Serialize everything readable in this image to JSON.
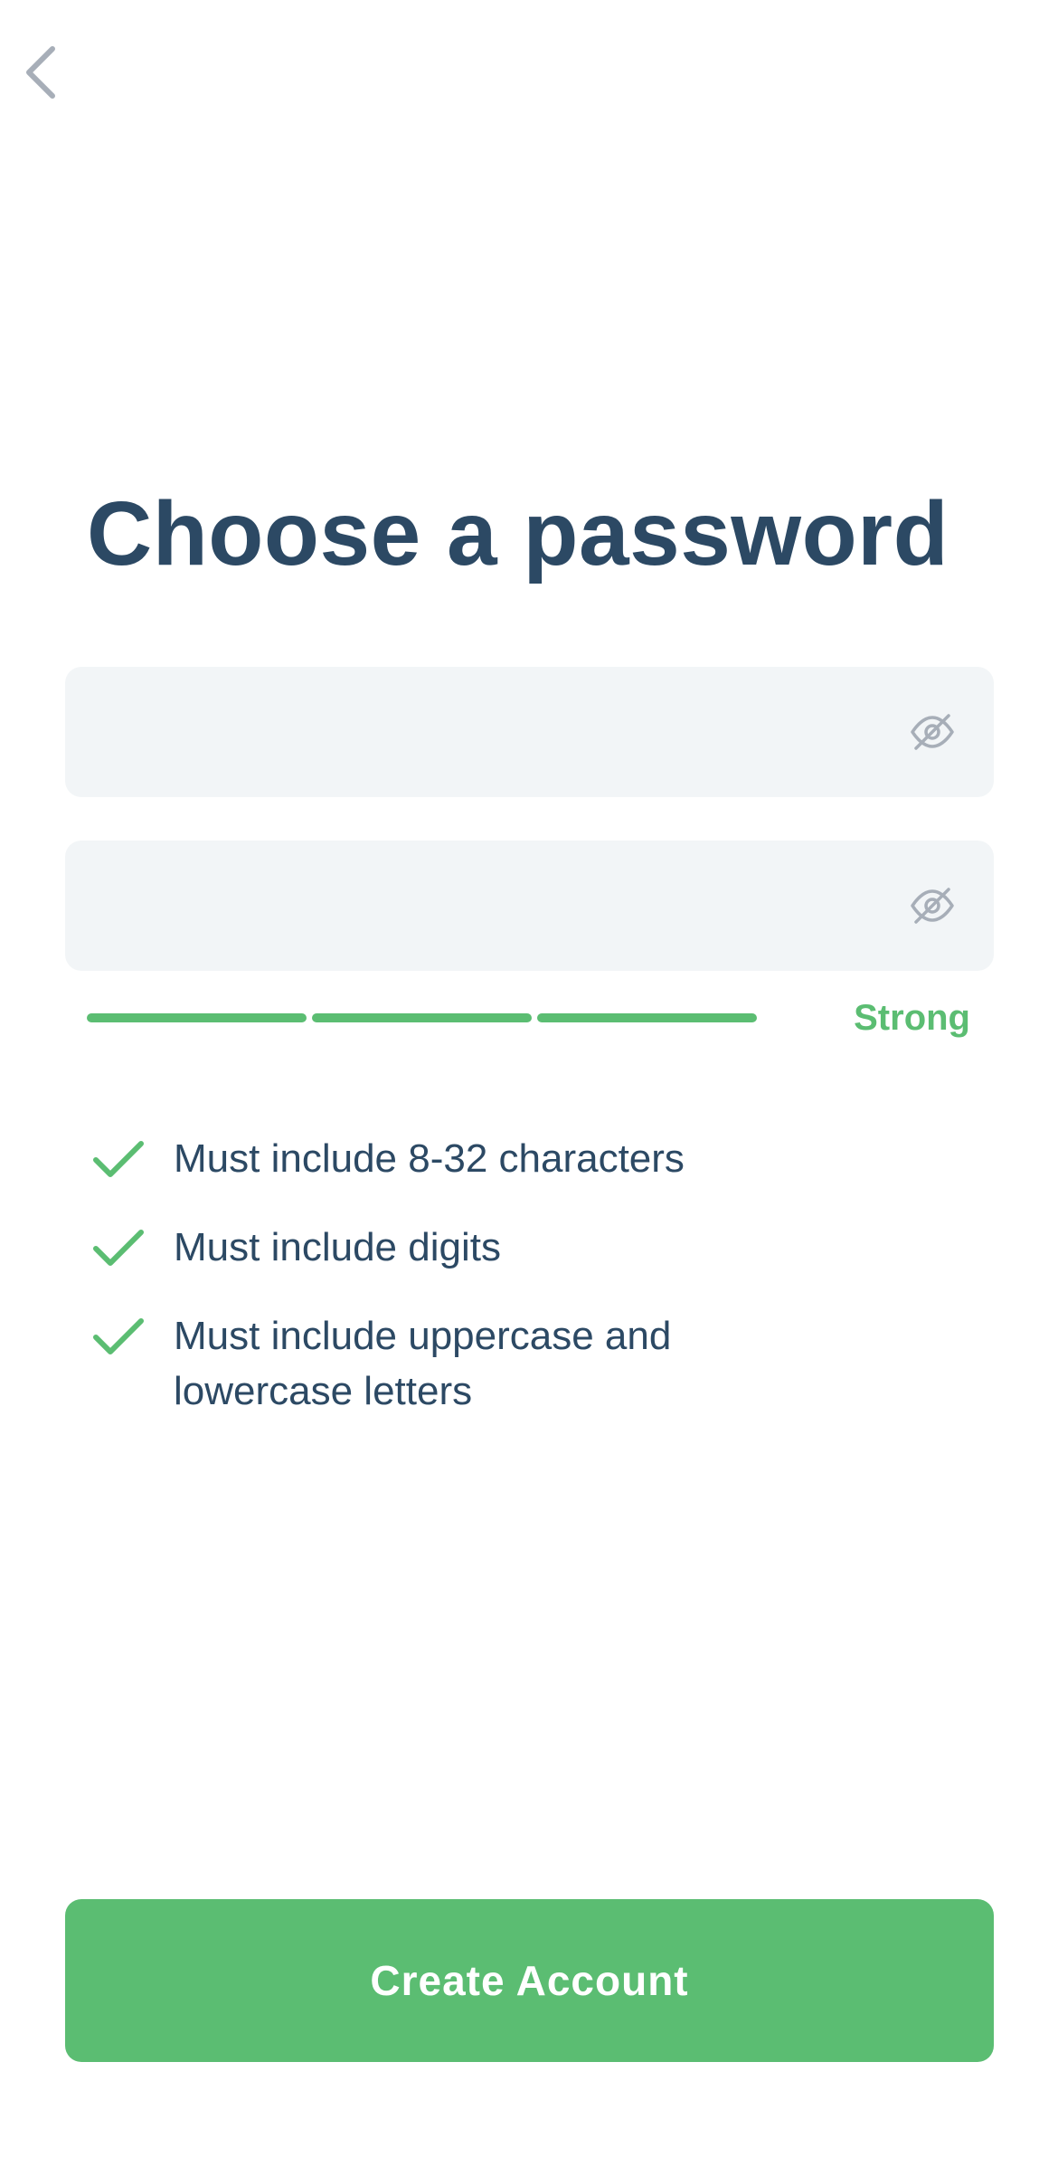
{
  "header": {
    "back_icon": "chevron-left-icon"
  },
  "title": "Choose a password",
  "fields": [
    {
      "value": "",
      "placeholder": "",
      "icon": "eye-off-icon"
    },
    {
      "value": "",
      "placeholder": "",
      "icon": "eye-off-icon"
    }
  ],
  "strength": {
    "label": "Strong",
    "level": 3,
    "max_level": 3,
    "color": "#5bbd72"
  },
  "requirements": [
    {
      "text": "Must include 8-32 characters",
      "met": true
    },
    {
      "text": "Must include digits",
      "met": true
    },
    {
      "text": "Must include uppercase and lowercase letters",
      "met": true
    }
  ],
  "create_button": {
    "label": "Create Account"
  },
  "colors": {
    "primary": "#5bbd72",
    "text": "#2c4964",
    "field_bg": "#f2f5f7",
    "icon_gray": "#a7aeb8"
  }
}
